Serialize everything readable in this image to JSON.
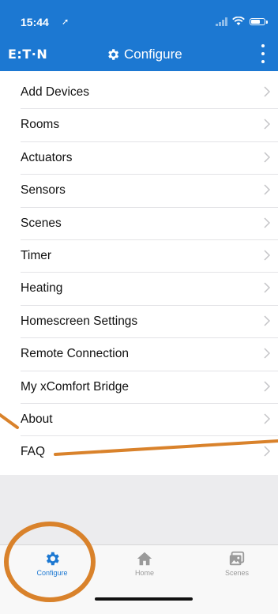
{
  "status_bar": {
    "time": "15:44"
  },
  "header": {
    "logo": "E:T·N",
    "title": "Configure"
  },
  "menu": [
    {
      "label": "Add Devices"
    },
    {
      "label": "Rooms"
    },
    {
      "label": "Actuators"
    },
    {
      "label": "Sensors"
    },
    {
      "label": "Scenes"
    },
    {
      "label": "Timer"
    },
    {
      "label": "Heating"
    },
    {
      "label": "Homescreen Settings"
    },
    {
      "label": "Remote Connection"
    },
    {
      "label": "My xComfort Bridge"
    },
    {
      "label": "About"
    },
    {
      "label": "FAQ"
    }
  ],
  "tabbar": {
    "tabs": [
      {
        "label": "Configure",
        "icon": "gear-icon",
        "active": true
      },
      {
        "label": "Home",
        "icon": "home-icon",
        "active": false
      },
      {
        "label": "Scenes",
        "icon": "scenes-icon",
        "active": false
      }
    ]
  },
  "colors": {
    "brand": "#1c78d2",
    "annotation": "#d9822b",
    "inactive_tab": "#9a9a9a"
  }
}
